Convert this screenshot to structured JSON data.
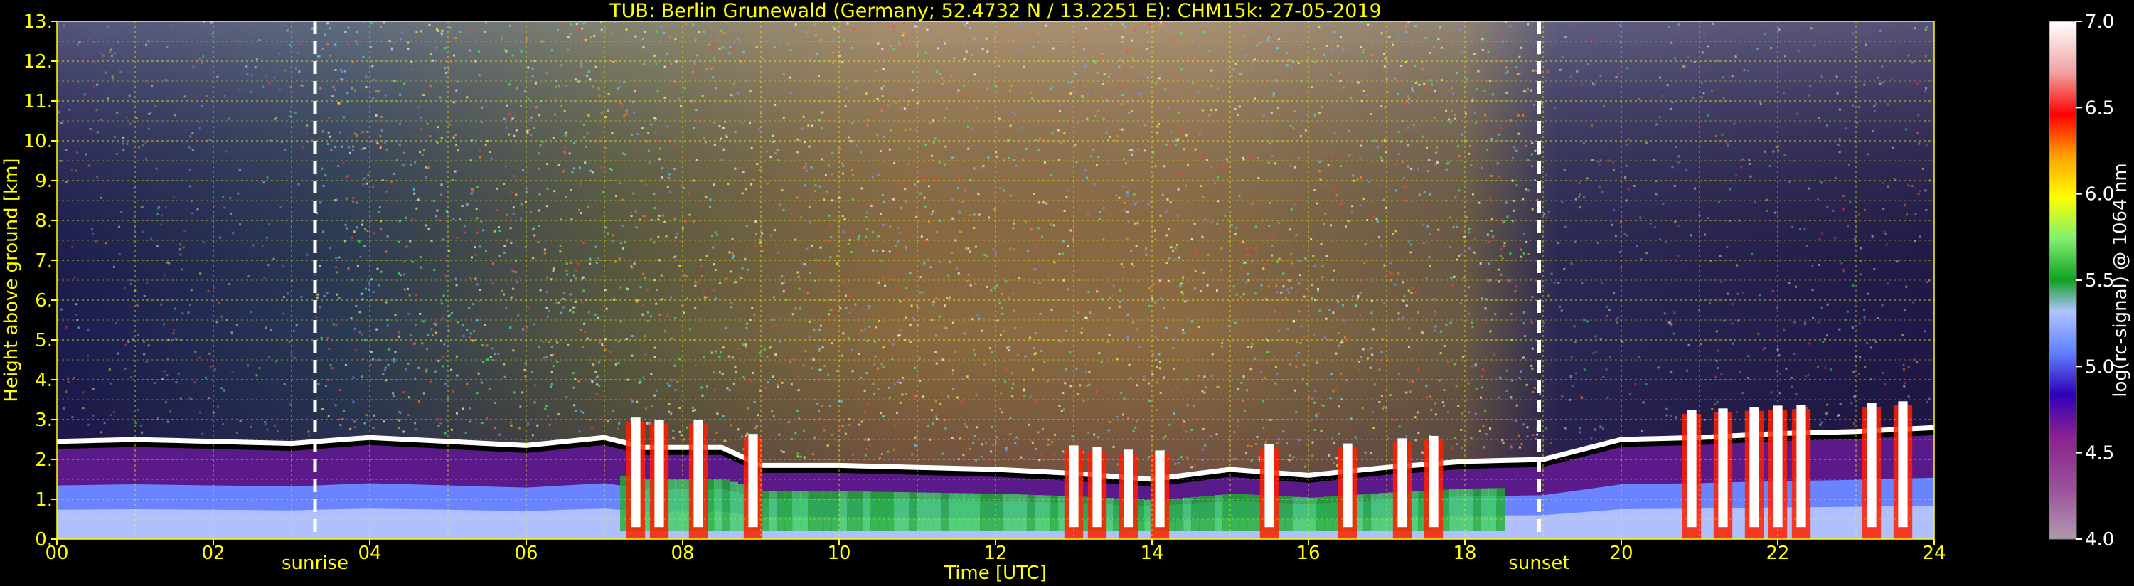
{
  "chart_data": {
    "type": "heatmap",
    "title": "TUB: Berlin Grunewald (Germany; 52.4732 N / 13.2251 E):    CHM15k: 27-05-2019",
    "xlabel": "Time [UTC]",
    "ylabel": "Height above ground [km]",
    "xlim": [
      0,
      24
    ],
    "ylim": [
      0,
      13
    ],
    "x_ticks": [
      "00",
      "02",
      "04",
      "06",
      "08",
      "10",
      "12",
      "14",
      "16",
      "18",
      "20",
      "22",
      "24"
    ],
    "y_ticks": [
      "0.",
      "1.",
      "2.",
      "3.",
      "4.",
      "5.",
      "6.",
      "7.",
      "8.",
      "9.",
      "10.",
      "11.",
      "12.",
      "13."
    ],
    "grid": true,
    "vlines": [
      {
        "label": "sunrise",
        "x": 3.3
      },
      {
        "label": "sunset",
        "x": 18.95
      }
    ],
    "colorbar": {
      "label": "log(rc-signal) @ 1064 nm",
      "range": [
        4.0,
        7.0
      ],
      "ticks": [
        "4.0",
        "4.5",
        "5.0",
        "5.5",
        "6.0",
        "6.5",
        "7.0"
      ],
      "colors": [
        "#b098b0",
        "#9c78a0",
        "#9a509a",
        "#8a2090",
        "#6a0098",
        "#3000b8",
        "#1030e0",
        "#3050f0",
        "#6080ff",
        "#90a8ff",
        "#b0c4ff",
        "#40c0b0",
        "#10a020",
        "#20c040",
        "#50d870",
        "#80f070",
        "#c0f040",
        "#ffff00",
        "#ffd000",
        "#ffa000",
        "#ff6000",
        "#ff2000",
        "#ff0000",
        "#f0a0a0",
        "#e0e0e0",
        "#ffffff"
      ]
    },
    "layer_top_km": [
      [
        0,
        2.45
      ],
      [
        1,
        2.5
      ],
      [
        2,
        2.45
      ],
      [
        3,
        2.4
      ],
      [
        4,
        2.55
      ],
      [
        5,
        2.45
      ],
      [
        6,
        2.35
      ],
      [
        7,
        2.55
      ],
      [
        7.5,
        2.3
      ],
      [
        8.5,
        2.3
      ],
      [
        9,
        1.85
      ],
      [
        10,
        1.85
      ],
      [
        11,
        1.8
      ],
      [
        12,
        1.75
      ],
      [
        13,
        1.65
      ],
      [
        14,
        1.5
      ],
      [
        15,
        1.75
      ],
      [
        16,
        1.6
      ],
      [
        17,
        1.8
      ],
      [
        18,
        1.95
      ],
      [
        19,
        2.0
      ],
      [
        20,
        2.5
      ],
      [
        21,
        2.55
      ],
      [
        22,
        2.65
      ],
      [
        23,
        2.7
      ],
      [
        24,
        2.8
      ]
    ]
  }
}
